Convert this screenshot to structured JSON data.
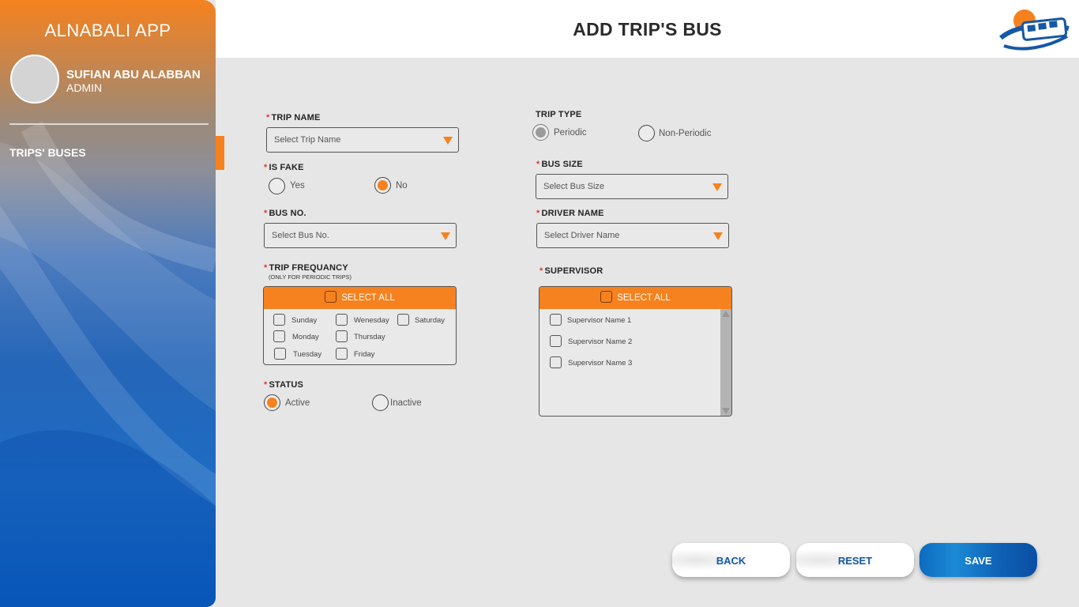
{
  "sidebar": {
    "app_title": "ALNABALI APP",
    "user_name": "SUFIAN ABU ALABBAN",
    "user_role": "ADMIN",
    "items": [
      {
        "label": "TRIPS' BUSES",
        "active": true
      }
    ]
  },
  "header": {
    "title": "ADD TRIP'S BUS",
    "logo_icon": "bus-logo-icon"
  },
  "form": {
    "trip_name": {
      "label": "TRIP NAME",
      "placeholder": "Select Trip Name"
    },
    "trip_type": {
      "label": "TRIP TYPE",
      "options": [
        "Periodic",
        "Non-Periodic"
      ],
      "selected": "Periodic"
    },
    "is_fake": {
      "label": "IS FAKE",
      "options": [
        "Yes",
        "No"
      ],
      "selected": "No"
    },
    "bus_size": {
      "label": "BUS SIZE",
      "placeholder": "Select Bus Size"
    },
    "bus_no": {
      "label": "BUS NO.",
      "placeholder": "Select Bus No."
    },
    "driver_name": {
      "label": "DRIVER NAME",
      "placeholder": "Select Driver Name"
    },
    "trip_frequency": {
      "label": "TRIP FREQUANCY",
      "note": "(ONLY FOR PERIODIC TRIPS)",
      "select_all": "SELECT ALL",
      "days": [
        "Sunday",
        "Wenesday",
        "Saturday",
        "Monday",
        "Thursday",
        "Tuesday",
        "Friday"
      ]
    },
    "supervisor": {
      "label": "SUPERVISOR",
      "select_all": "SELECT ALL",
      "items": [
        "Supervisor Name 1",
        "Supervisor Name 2",
        "Supervisor Name 3"
      ]
    },
    "status": {
      "label": "STATUS",
      "options": [
        "Active",
        "Inactive"
      ],
      "selected": "Active"
    }
  },
  "buttons": {
    "back": "BACK",
    "reset": "RESET",
    "save": "SAVE"
  },
  "colors": {
    "accent": "#f5821f",
    "primary": "#1558a6",
    "background": "#e6e6e6"
  }
}
